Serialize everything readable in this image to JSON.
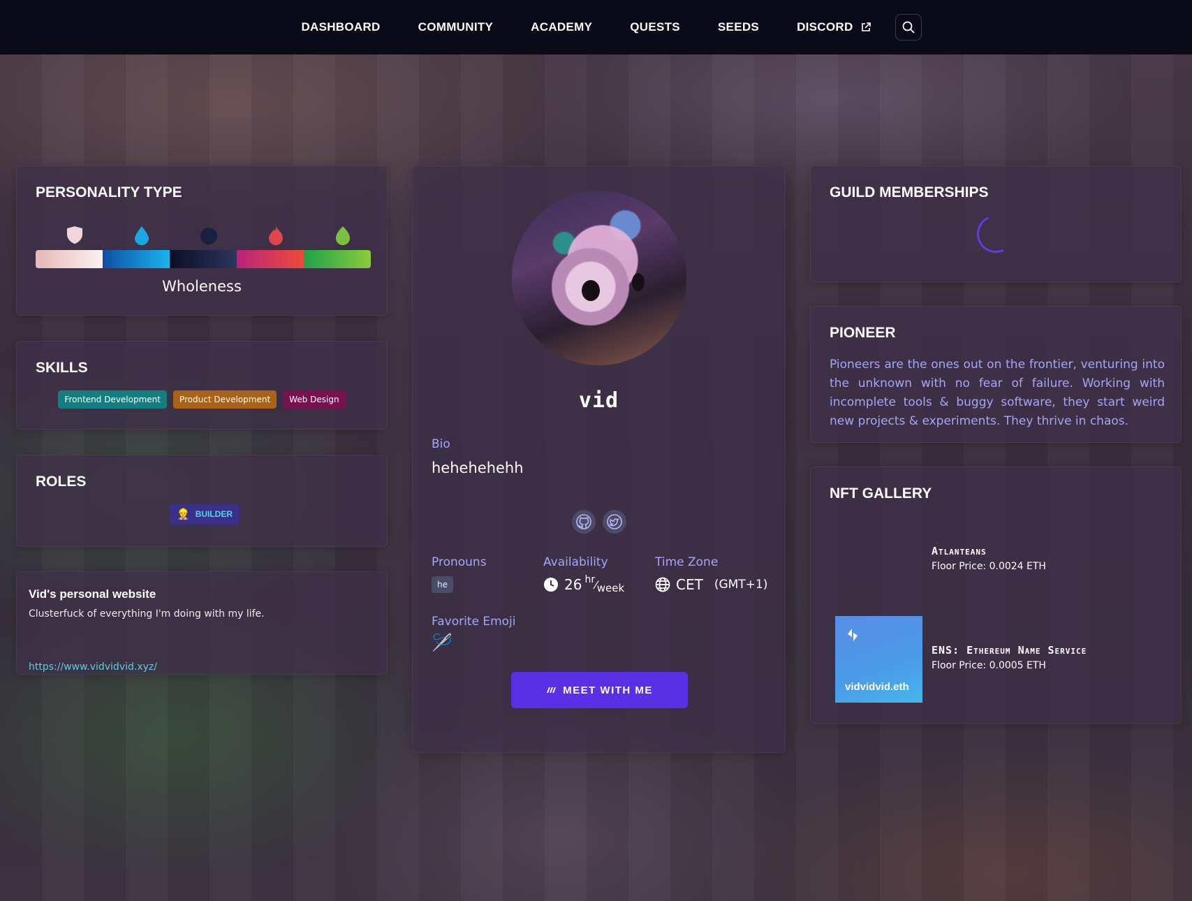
{
  "nav": {
    "items": [
      {
        "label": "DASHBOARD"
      },
      {
        "label": "COMMUNITY"
      },
      {
        "label": "ACADEMY"
      },
      {
        "label": "QUESTS"
      },
      {
        "label": "SEEDS"
      },
      {
        "label": "DISCORD",
        "external": true
      }
    ],
    "search_icon": "search-icon"
  },
  "personality": {
    "title": "PERSONALITY TYPE",
    "label": "Wholeness",
    "icons": [
      "shield-icon",
      "water-drop-icon",
      "moon-icon",
      "flame-icon",
      "leaf-icon"
    ],
    "colors": [
      "#f0d6d8",
      "#1aa7e6",
      "#1a2040",
      "#e0474a",
      "#7ac142"
    ]
  },
  "skills": {
    "title": "SKILLS",
    "items": [
      {
        "label": "Frontend Development",
        "color": "#137e80"
      },
      {
        "label": "Product Development",
        "color": "#a8621a"
      },
      {
        "label": "Web Design",
        "color": "#78124f"
      }
    ]
  },
  "roles": {
    "title": "ROLES",
    "items": [
      {
        "label": "BUILDER",
        "emoji": "👷"
      }
    ]
  },
  "website": {
    "title": "Vid's personal website",
    "description": "Clusterfuck of everything I'm doing with my life.",
    "url": "https://www.vidvidvid.xyz/"
  },
  "profile": {
    "username": "vid",
    "bio_label": "Bio",
    "bio": "hehehehehh",
    "pronouns_label": "Pronouns",
    "pronouns": "he",
    "availability_label": "Availability",
    "availability_hours": "26",
    "availability_unit_top": "hr",
    "availability_unit_bottom": "week",
    "timezone_label": "Time Zone",
    "timezone": "CET",
    "timezone_offset": "(GMT+1)",
    "favorite_emoji_label": "Favorite Emoji",
    "favorite_emoji": "🪡",
    "meet_button": "MEET WITH ME",
    "social": [
      "github-icon",
      "twitter-icon"
    ]
  },
  "guilds": {
    "title": "GUILD MEMBERSHIPS"
  },
  "pioneer": {
    "title": "PIONEER",
    "text": "Pioneers are the ones out on the frontier, venturing into the unknown with no fear of failure. Working with incomplete tools & buggy software, they start weird new projects & experiments. They thrive in chaos."
  },
  "nft": {
    "title": "NFT GALLERY",
    "items": [
      {
        "name": "Atlanteans",
        "price": "Floor Price: 0.0024 ETH"
      },
      {
        "name": "ENS: Ethereum Name Service",
        "price": "Floor Price: 0.0005 ETH",
        "tile_label": "vidvidvid.eth"
      }
    ]
  }
}
